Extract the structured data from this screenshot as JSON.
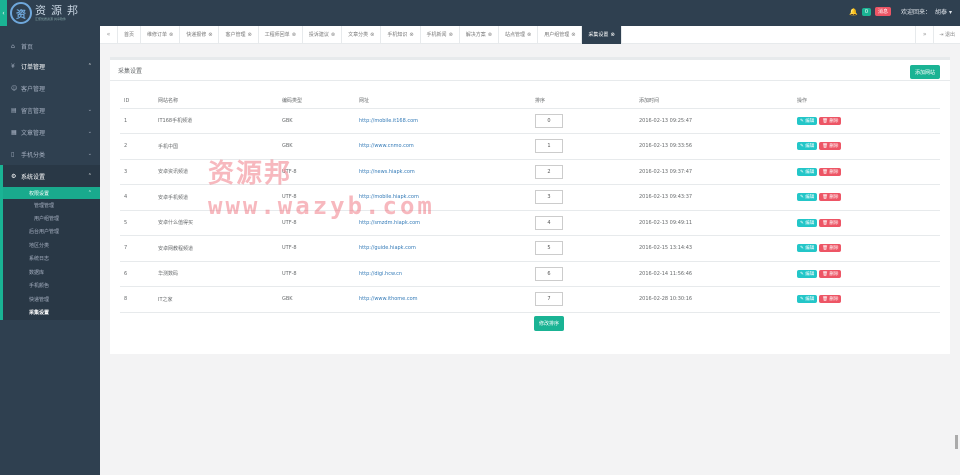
{
  "brand": {
    "logo_mark": "资",
    "title": "资源邦",
    "subtitle": "汇聚优质资源 共享软件"
  },
  "header": {
    "badge_green": "0",
    "badge_red": "消息",
    "welcome": "欢迎回来：",
    "user": "胡泰"
  },
  "sidebar": {
    "items": [
      {
        "label": "首页",
        "icon": "home-icon"
      },
      {
        "label": "订单管理",
        "icon": "order-icon"
      },
      {
        "label": "客户管理",
        "icon": "users-icon"
      },
      {
        "label": "留言管理",
        "icon": "message-icon"
      },
      {
        "label": "文章管理",
        "icon": "article-icon"
      },
      {
        "label": "手机分类",
        "icon": "mobile-icon"
      },
      {
        "label": "系统设置",
        "icon": "gear-icon"
      }
    ],
    "system_sub": {
      "label": "权限设置",
      "children": [
        "管理管理",
        "用户组管理"
      ]
    },
    "system_items": [
      "后台用户管理",
      "地区分类",
      "系统日志",
      "数据库",
      "手机颜色",
      "快递管理",
      "采集设置"
    ]
  },
  "tabs": {
    "items": [
      "首页",
      "维修订单",
      "快递报修",
      "客户管理",
      "工程师回单",
      "投诉建议",
      "文章分类",
      "手机知识",
      "手机新闻",
      "解决方案",
      "站点管理",
      "用户组管理",
      "采集设置"
    ],
    "exit": "退出"
  },
  "panel": {
    "title": "采集设置",
    "add_button": "添加网站",
    "save_button": "修改排序"
  },
  "table": {
    "headers": [
      "ID",
      "网站名称",
      "编码类型",
      "网址",
      "排序",
      "添加时间",
      "操作"
    ],
    "edit_label": "编辑",
    "delete_label": "删除",
    "rows": [
      {
        "id": "1",
        "name": "IT168手机频道",
        "encoding": "GBK",
        "url": "http://mobile.it168.com",
        "sort": "0",
        "time": "2016-02-13 09:25:47"
      },
      {
        "id": "2",
        "name": "手机中国",
        "encoding": "GBK",
        "url": "http://www.cnmo.com",
        "sort": "1",
        "time": "2016-02-13 09:33:56"
      },
      {
        "id": "3",
        "name": "安卓资讯频道",
        "encoding": "UTF-8",
        "url": "http://news.hiapk.com",
        "sort": "2",
        "time": "2016-02-13 09:37:47"
      },
      {
        "id": "4",
        "name": "安卓手机频道",
        "encoding": "UTF-8",
        "url": "http://mobile.hiapk.com",
        "sort": "3",
        "time": "2016-02-13 09:43:37"
      },
      {
        "id": "5",
        "name": "安卓什么值得买",
        "encoding": "UTF-8",
        "url": "http://smzdm.hiapk.com",
        "sort": "4",
        "time": "2016-02-13 09:49:11"
      },
      {
        "id": "7",
        "name": "安卓网教程频道",
        "encoding": "UTF-8",
        "url": "http://guide.hiapk.com",
        "sort": "5",
        "time": "2016-02-15 13:14:43"
      },
      {
        "id": "6",
        "name": "华测数码",
        "encoding": "UTF-8",
        "url": "http://digi.hcw.cn",
        "sort": "6",
        "time": "2016-02-14 11:56:46"
      },
      {
        "id": "8",
        "name": "IT之家",
        "encoding": "GBK",
        "url": "http://www.ithome.com",
        "sort": "7",
        "time": "2016-02-28 10:30:16"
      }
    ]
  },
  "watermark": {
    "line1": "资源邦",
    "line2": "www.wazyb.com"
  },
  "colors": {
    "sidebar": "#2f4050",
    "accent": "#1ab394",
    "danger": "#ed5565",
    "info": "#23c6c8"
  }
}
